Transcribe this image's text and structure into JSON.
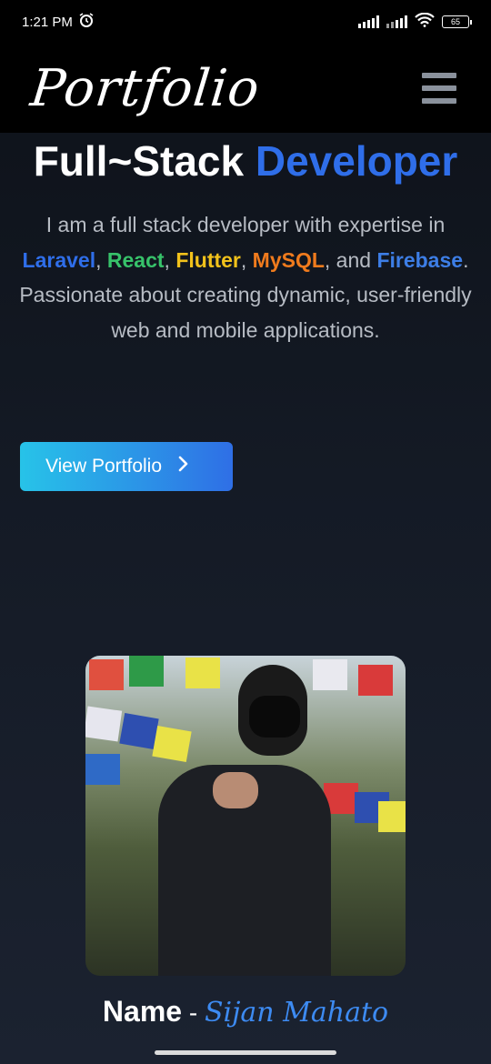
{
  "status_bar": {
    "time": "1:21 PM",
    "battery": "65"
  },
  "navbar": {
    "logo": "Portfolio"
  },
  "hero": {
    "title_part1": "Full~Stack ",
    "title_part2": "Developer",
    "desc_intro": "I am a full stack developer with expertise in ",
    "skills": [
      {
        "label": "Laravel",
        "color": "#2f6ee9"
      },
      {
        "label": "React",
        "color": "#37c26a"
      },
      {
        "label": "Flutter",
        "color": "#f2c21b"
      },
      {
        "label": "MySQL",
        "color": "#f07b1d"
      },
      {
        "label": "Firebase",
        "color": "#3d7ee6"
      }
    ],
    "sep_comma": ", ",
    "sep_and": ", and ",
    "desc_outro": ". Passionate about creating dynamic, user-friendly web and mobile applications.",
    "cta_label": "View Portfolio",
    "cta_icon": "chevron-right-icon"
  },
  "profile": {
    "name_label": "Name",
    "separator": " - ",
    "name_value": "Sijan Mahato"
  },
  "colors": {
    "accent": "#2f6ee9",
    "button_start": "#27c3e8",
    "button_end": "#2f6fe6",
    "name_script": "#3d8bf2"
  }
}
